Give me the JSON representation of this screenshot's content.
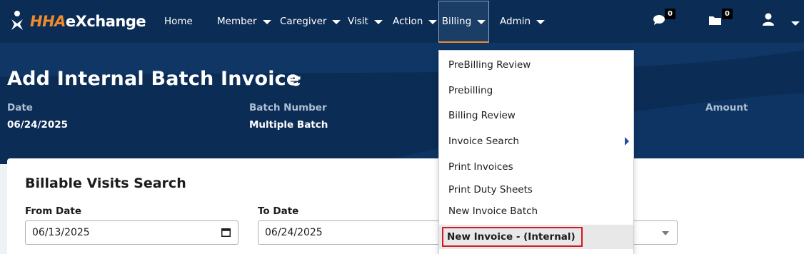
{
  "brand": {
    "logo_hha": "HHA",
    "logo_ex": "eXchange"
  },
  "nav": {
    "home": "Home",
    "member": "Member",
    "caregiver": "Caregiver",
    "visit": "Visit",
    "action": "Action",
    "billing": "Billing",
    "admin": "Admin",
    "messages_count": "0",
    "folder_count": "0",
    "icons": [
      "chat-icon",
      "folder-icon",
      "user-icon"
    ]
  },
  "page": {
    "title": "Add Internal Batch Invoice",
    "header_fields": {
      "date_label": "Date",
      "date_value": "06/24/2025",
      "batch_label": "Batch Number",
      "batch_value": "Multiple Batch",
      "amount_label": "Amount"
    }
  },
  "search": {
    "title": "Billable Visits Search",
    "from_label": "From Date",
    "from_value": "06/13/2025",
    "to_label": "To Date",
    "to_value": "06/24/2025"
  },
  "billing_menu": {
    "items": [
      "PreBilling Review",
      "Prebilling",
      "Billing Review",
      "Invoice Search",
      "Print Invoices",
      "Print Duty Sheets",
      "New Invoice Batch",
      "New Invoice - (Internal)"
    ],
    "submenu_item": "Invoice Search",
    "highlighted_item": "New Invoice - (Internal)"
  },
  "colors": {
    "nav_bg": "#0b2c55",
    "brand_orange": "#f08a2c",
    "highlight_red": "#d71920",
    "submenu_arrow": "#2a4f9a"
  }
}
